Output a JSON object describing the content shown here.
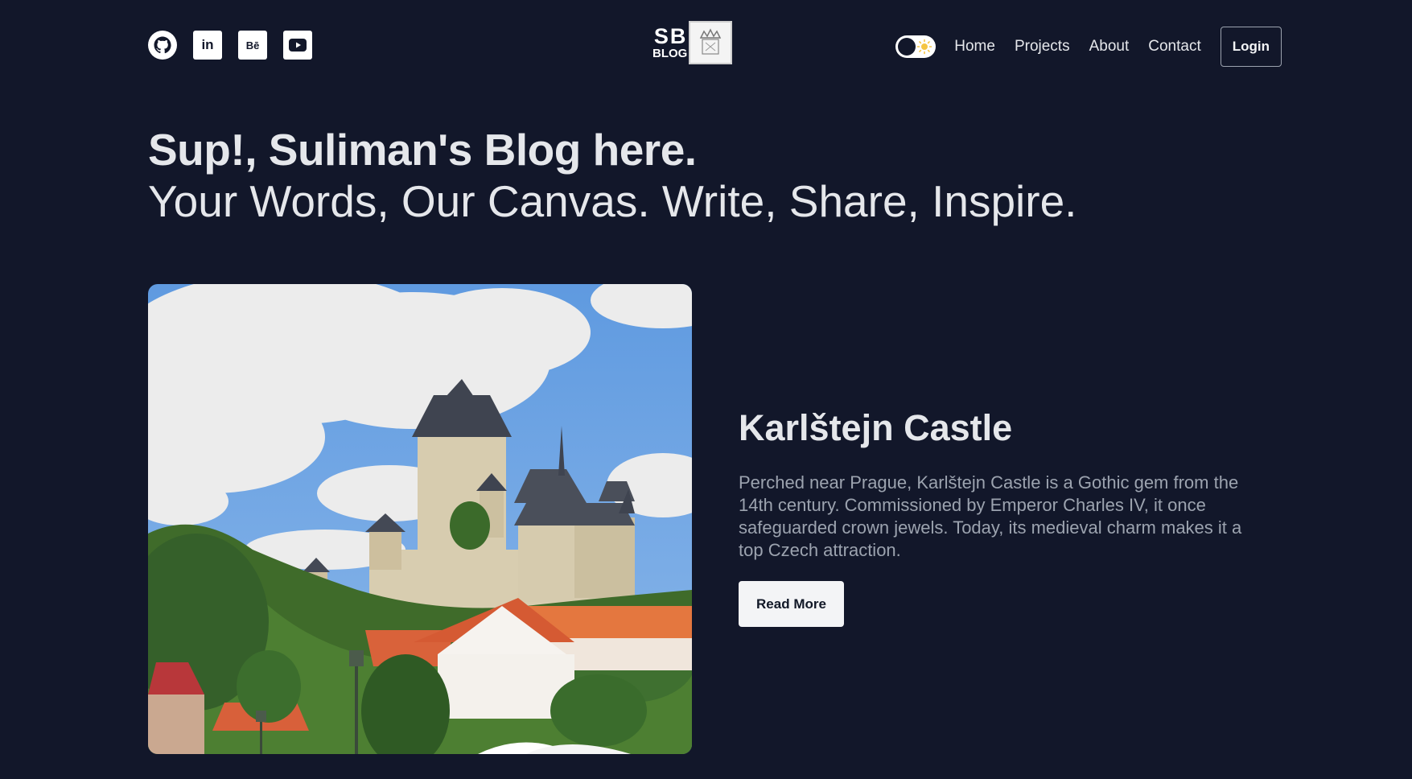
{
  "header": {
    "socials": [
      {
        "icon": "github-icon"
      },
      {
        "icon": "linkedin-icon",
        "glyph": "in"
      },
      {
        "icon": "behance-icon",
        "glyph": "Bē"
      },
      {
        "icon": "youtube-icon"
      }
    ],
    "brand": {
      "line1": "SB",
      "line2": "BLOG"
    },
    "nav": {
      "home": "Home",
      "projects": "Projects",
      "about": "About",
      "contact": "Contact"
    },
    "login_label": "Login",
    "theme_toggle": {
      "state": "dark",
      "icon": "sun-icon"
    }
  },
  "hero": {
    "title": "Sup!, Suliman's Blog here.",
    "subtitle": "Your Words, Our Canvas. Write, Share, Inspire."
  },
  "feature": {
    "image_icon": "castle-photo",
    "title": "Karlštejn Castle",
    "text": "Perched near Prague, Karlštejn Castle is a Gothic gem from the 14th century. Commissioned by Emperor Charles IV, it once safeguarded crown jewels. Today, its medieval charm makes it a top Czech attraction.",
    "button_label": "Read More"
  },
  "colors": {
    "background": "#12172a",
    "text": "#e5e7eb",
    "muted": "#9ca3af",
    "button": "#f3f4f6"
  }
}
